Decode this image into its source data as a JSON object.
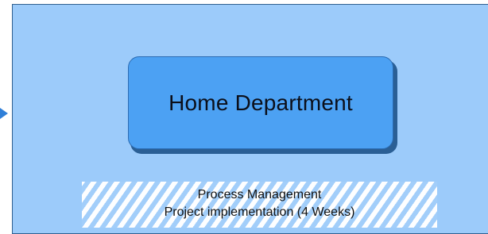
{
  "diagram": {
    "home_box": {
      "label": "Home Department"
    },
    "bottom_box": {
      "line1": "Process Management",
      "line2": "Project implementation (4 Weeks)"
    }
  },
  "colors": {
    "outer_fill": "#9ccbfa",
    "home_fill": "#4ca1f3",
    "arrow": "#2f7fd8"
  }
}
